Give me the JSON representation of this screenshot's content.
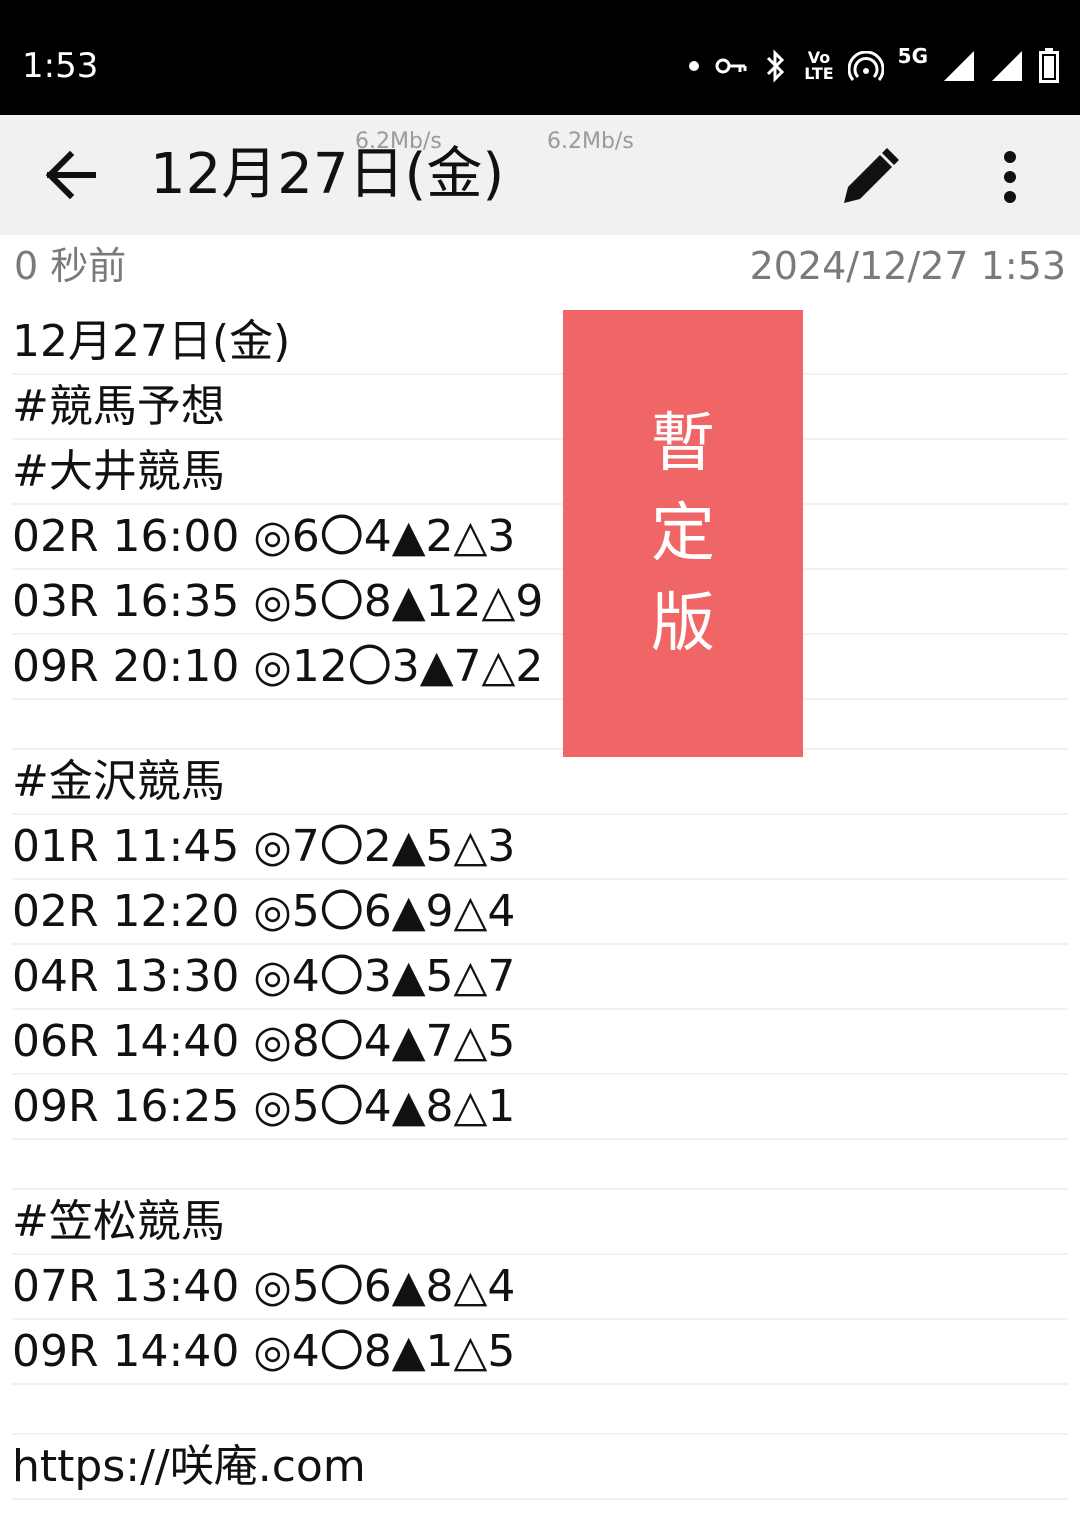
{
  "status_bar": {
    "time": "1:53",
    "network_label": "5G",
    "volte_top": "Vo",
    "volte_bottom": "LTE"
  },
  "app_bar": {
    "title": "12月27日(金)",
    "speed_1": "6.2Mb/s",
    "speed_2": "6.2Mb/s"
  },
  "meta": {
    "relative_time": "0 秒前",
    "timestamp": "2024/12/27 1:53"
  },
  "note": {
    "lines": [
      "12月27日(金)",
      "#競馬予想",
      "#大井競馬",
      "02R 16:00 ◎6〇4▲2△3",
      "03R 16:35 ◎5〇8▲12△9",
      "09R 20:10 ◎12〇3▲7△2",
      "",
      "#金沢競馬",
      "01R 11:45 ◎7〇2▲5△3",
      "02R 12:20 ◎5〇6▲9△4",
      "04R 13:30 ◎4〇3▲5△7",
      "06R 14:40 ◎8〇4▲7△5",
      "09R 16:25 ◎5〇4▲8△1",
      "",
      "#笠松競馬",
      "07R 13:40 ◎5〇6▲8△4",
      "09R 14:40 ◎4〇8▲1△5",
      "",
      "https://咲庵.com"
    ]
  },
  "stamp": {
    "chars": [
      "暫",
      "定",
      "版"
    ],
    "color": "#f06666"
  },
  "icons": {
    "back": "arrow-left-icon",
    "edit": "pencil-icon",
    "more": "more-vertical-icon"
  }
}
